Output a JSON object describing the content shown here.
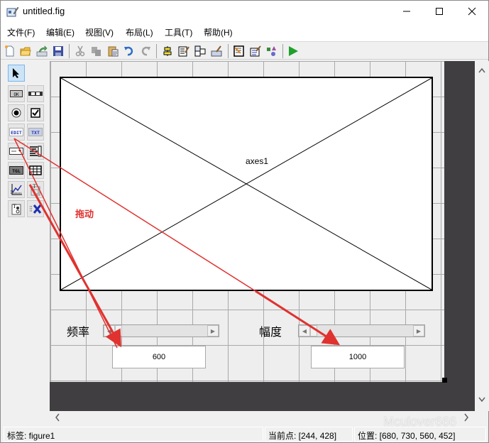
{
  "window": {
    "title": "untitled.fig",
    "controls": {
      "minimize": "minimize-icon",
      "maximize": "maximize-icon",
      "close": "close-icon"
    }
  },
  "menu": {
    "items": [
      {
        "label": "文件(F)"
      },
      {
        "label": "编辑(E)"
      },
      {
        "label": "视图(V)"
      },
      {
        "label": "布局(L)"
      },
      {
        "label": "工具(T)"
      },
      {
        "label": "帮助(H)"
      }
    ]
  },
  "toolbar": {
    "buttons": [
      {
        "name": "new-file",
        "icon": "new-file-icon"
      },
      {
        "name": "open",
        "icon": "open-folder-icon"
      },
      {
        "name": "export",
        "icon": "export-icon"
      },
      {
        "name": "save",
        "icon": "save-icon"
      },
      {
        "name": "cut",
        "icon": "cut-icon"
      },
      {
        "name": "copy",
        "icon": "copy-icon"
      },
      {
        "name": "paste",
        "icon": "paste-icon"
      },
      {
        "name": "undo",
        "icon": "undo-icon"
      },
      {
        "name": "redo",
        "icon": "redo-icon"
      },
      {
        "name": "align",
        "icon": "align-icon"
      },
      {
        "name": "menu-editor",
        "icon": "menu-editor-icon"
      },
      {
        "name": "tab-order",
        "icon": "tab-order-icon"
      },
      {
        "name": "toolbar-editor",
        "icon": "toolbar-editor-icon"
      },
      {
        "name": "editor",
        "icon": "editor-icon"
      },
      {
        "name": "property-inspector",
        "icon": "property-inspector-icon"
      },
      {
        "name": "object-browser",
        "icon": "object-browser-icon"
      },
      {
        "name": "run",
        "icon": "run-icon"
      }
    ]
  },
  "palette": {
    "items": [
      {
        "name": "select",
        "icon": "pointer-icon",
        "selected": true
      },
      {
        "name": "push-button",
        "icon": "push-button-icon",
        "text": "OK"
      },
      {
        "name": "slider",
        "icon": "slider-icon"
      },
      {
        "name": "radio-button",
        "icon": "radio-button-icon"
      },
      {
        "name": "check-box",
        "icon": "check-box-icon"
      },
      {
        "name": "edit-text",
        "icon": "edit-text-icon",
        "text": "EDIT"
      },
      {
        "name": "static-text",
        "icon": "static-text-icon",
        "text": "TXT"
      },
      {
        "name": "pop-up-menu",
        "icon": "popup-menu-icon"
      },
      {
        "name": "list-box",
        "icon": "list-box-icon"
      },
      {
        "name": "toggle-button",
        "icon": "toggle-button-icon",
        "text": "TGL"
      },
      {
        "name": "table",
        "icon": "table-icon"
      },
      {
        "name": "axes",
        "icon": "axes-icon"
      },
      {
        "name": "panel",
        "icon": "panel-icon"
      },
      {
        "name": "button-group",
        "icon": "button-group-icon"
      },
      {
        "name": "activex",
        "icon": "activex-icon"
      }
    ]
  },
  "canvas": {
    "axes_label": "axes1",
    "freq_label": "频率",
    "amp_label": "幅度",
    "freq_slider_position": 0.0,
    "amp_slider_position": 0.0,
    "freq_edit_value": "600",
    "amp_edit_value": "1000"
  },
  "annotation": {
    "drag_label": "拖动",
    "arrow_color": "#e0322f"
  },
  "status": {
    "tag": "标签: figure1",
    "current_point": "当前点:  [244, 428]",
    "position": "位置: [680, 730, 560, 452]"
  },
  "watermark": "Mculover666"
}
